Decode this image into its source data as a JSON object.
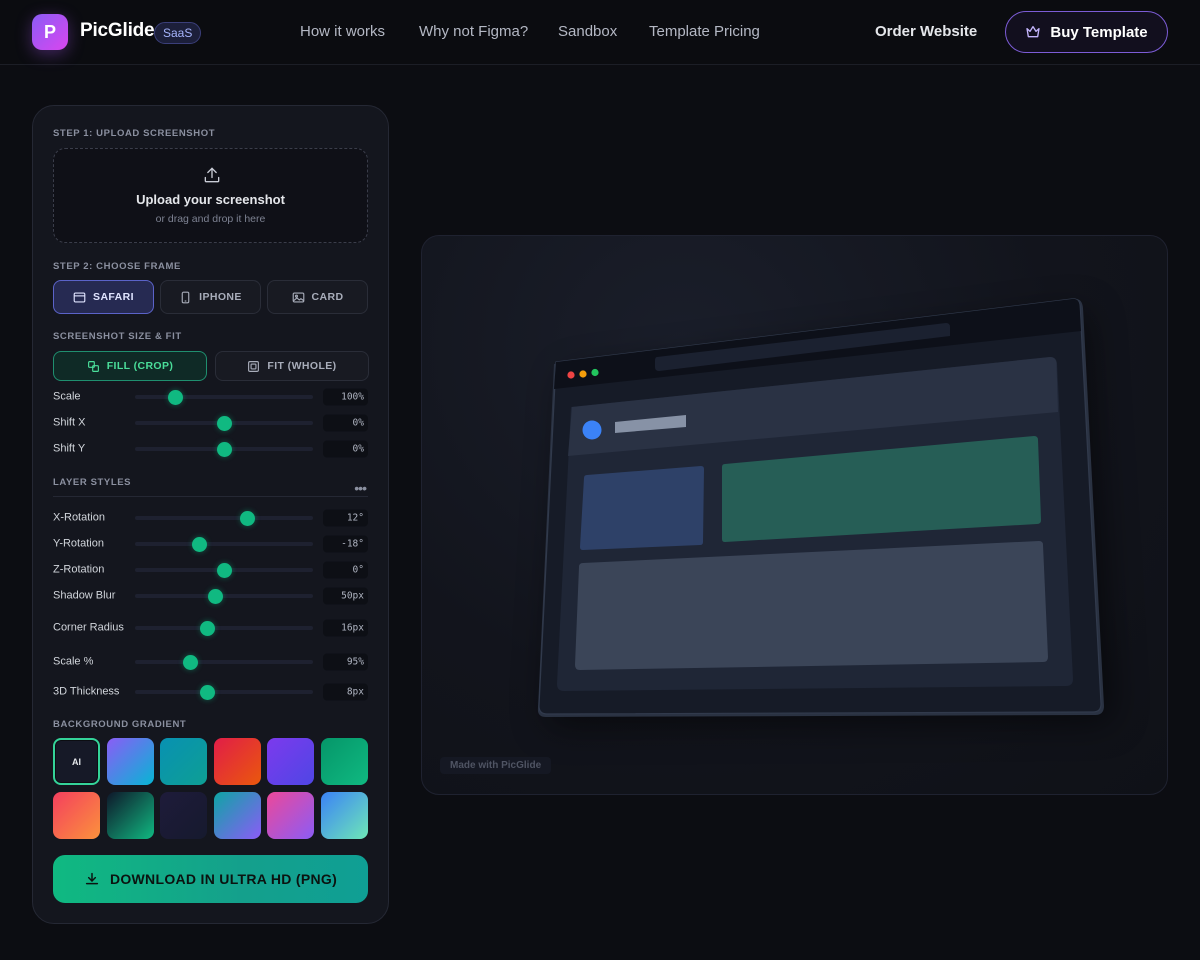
{
  "nav": {
    "logo_letter": "P",
    "brand": "PicGlide",
    "badge": "SaaS",
    "links": [
      "How it works",
      "Why not Figma?",
      "Sandbox",
      "Template Pricing"
    ],
    "order_link": "Order Website",
    "buy_button": "Buy Template"
  },
  "panel": {
    "step1_label": "STEP 1: UPLOAD SCREENSHOT",
    "upload_title": "Upload your screenshot",
    "upload_sub": "or drag and drop it here",
    "step2_label": "STEP 2: CHOOSE FRAME",
    "frames": [
      {
        "label": "SAFARI",
        "icon": "browser-window-icon",
        "active": true
      },
      {
        "label": "IPHONE",
        "icon": "phone-icon",
        "active": false
      },
      {
        "label": "CARD",
        "icon": "image-icon",
        "active": false
      }
    ],
    "size_fit_label": "SCREENSHOT SIZE & FIT",
    "fit_options": [
      {
        "label": "FILL (CROP)",
        "icon": "crop-icon",
        "active": true
      },
      {
        "label": "FIT (WHOLE)",
        "icon": "fit-icon",
        "active": false
      }
    ],
    "fit_sliders": [
      {
        "label": "Scale",
        "value": "100%",
        "fraction": 0.23
      },
      {
        "label": "Shift X",
        "value": "0%",
        "fraction": 0.5
      },
      {
        "label": "Shift Y",
        "value": "0%",
        "fraction": 0.5
      }
    ],
    "layer_styles_label": "LAYER STYLES",
    "layer_sliders": [
      {
        "label": "X-Rotation",
        "value": "12°",
        "fraction": 0.63
      },
      {
        "label": "Y-Rotation",
        "value": "-18°",
        "fraction": 0.36
      },
      {
        "label": "Z-Rotation",
        "value": "0°",
        "fraction": 0.5
      },
      {
        "label": "Shadow Blur",
        "value": "50px",
        "fraction": 0.45
      },
      {
        "label": "Corner Radius",
        "value": "16px",
        "fraction": 0.41
      },
      {
        "label": "Scale %",
        "value": "95%",
        "fraction": 0.31
      },
      {
        "label": "3D Thickness",
        "value": "8px",
        "fraction": 0.41
      }
    ],
    "background_label": "BACKGROUND GRADIENT",
    "gradients": [
      {
        "label": "AI",
        "selected": true,
        "from": "#161927",
        "to": "#161927"
      },
      {
        "label": "",
        "from": "#8b5cf6",
        "to": "#06b6d4"
      },
      {
        "label": "",
        "from": "#0891b2",
        "to": "#0e9f94"
      },
      {
        "label": "",
        "from": "#e11d48",
        "to": "#ea580c"
      },
      {
        "label": "",
        "from": "#7c3aed",
        "to": "#4f46e5"
      },
      {
        "label": "",
        "from": "#059669",
        "to": "#10b981"
      },
      {
        "label": "",
        "from": "#f43f5e",
        "to": "#fb923c"
      },
      {
        "label": "",
        "from": "#0f172a",
        "to": "#10b981"
      },
      {
        "label": "",
        "from": "#1e1b3a",
        "to": "#161a2e"
      },
      {
        "label": "",
        "from": "#0ea5a4",
        "to": "#8b5cf6"
      },
      {
        "label": "",
        "from": "#ec4899",
        "to": "#8b5cf6"
      },
      {
        "label": "",
        "from": "#3b82f6",
        "to": "#6ee7b7"
      }
    ],
    "download_button": "DOWNLOAD IN ULTRA HD (PNG)"
  },
  "preview": {
    "watermark": "Made with PicGlide",
    "colors": {
      "accent": "#10b981",
      "brand": "#8b5cf6"
    }
  }
}
